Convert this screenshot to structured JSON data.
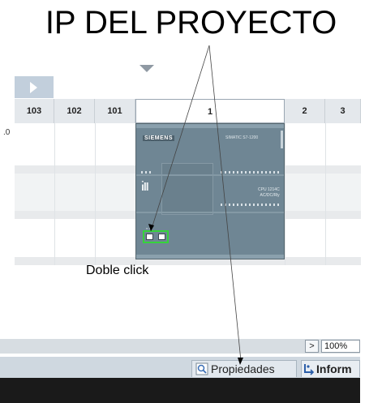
{
  "annotation": {
    "title": "IP DEL PROYECTO",
    "note": "Doble click"
  },
  "rack": {
    "columns": [
      "103",
      "102",
      "101",
      "1",
      "2",
      "3"
    ],
    "selected_column": "1",
    "slot_index": ".0"
  },
  "plc": {
    "brand": "SIEMENS",
    "model": "SIMATIC S7-1200",
    "cpu_label": [
      "CPU 1214C",
      "AC/DC/Rly"
    ]
  },
  "statusbar": {
    "zoom": "100%",
    "scroll_right_glyph": ">"
  },
  "tabs": {
    "properties": "Propiedades",
    "info": "Inform"
  },
  "colors": {
    "highlight_green": "#35d43a",
    "plc_body": "#6f8694",
    "tab_bar": "#cfd8e0"
  },
  "icons": [
    "collapse-arrow-icon",
    "play-icon",
    "properties-icon",
    "info-icon"
  ]
}
